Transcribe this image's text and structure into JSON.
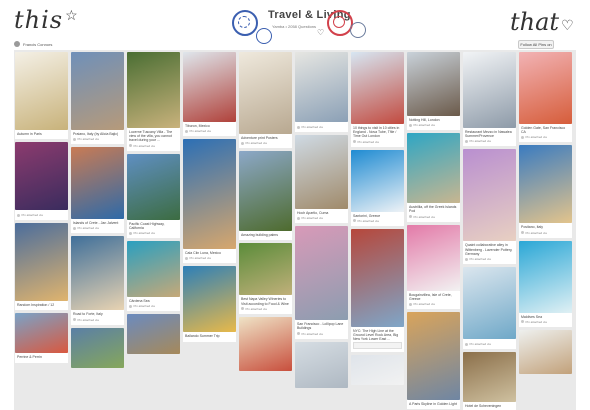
{
  "header": {
    "left_script": "this",
    "right_script": "that",
    "board_title": "Travel & Living",
    "board_meta": "Yamba • 2058 Questions",
    "user_name": "Francis Connors",
    "follow_label": "Follow All Pins on Board",
    "star_glyph": "☆",
    "heart_glyph": "♡"
  },
  "columns": [
    {
      "pins": [
        {
          "h": 78,
          "c1": "#f4f0e6",
          "c2": "#c8b27a",
          "desc": "Autumn in Paris",
          "via": "",
          "comment": false
        },
        {
          "h": 68,
          "c1": "#8c3b6e",
          "c2": "#3a2c5e",
          "desc": "",
          "via": "Pin attached via",
          "comment": false
        },
        {
          "h": 78,
          "c1": "#4b6d9c",
          "c2": "#e0b46e",
          "desc": "Random Inspiration / 12",
          "via": "",
          "comment": false
        },
        {
          "h": 40,
          "c1": "#7aa3c8",
          "c2": "#d9583f",
          "desc": "Perrine & Perrin",
          "via": "",
          "comment": false
        }
      ]
    },
    {
      "pins": [
        {
          "h": 78,
          "c1": "#6f90b9",
          "c2": "#b69a7a",
          "desc": "Praiano, Italy (by Alicia Bajic)",
          "via": "Pin attached via",
          "comment": false
        },
        {
          "h": 72,
          "c1": "#c97b54",
          "c2": "#2e6aa8",
          "desc": "Islands of Crete - Jan Jalvent",
          "via": "Pin attached via",
          "comment": false
        },
        {
          "h": 74,
          "c1": "#3f6f9a",
          "c2": "#e8d3b2",
          "desc": "Road to Forte, Italy",
          "via": "Pin attached via",
          "comment": false
        },
        {
          "h": 40,
          "c1": "#5a7fa6",
          "c2": "#86a75b",
          "desc": "",
          "via": "",
          "comment": false
        }
      ]
    },
    {
      "pins": [
        {
          "h": 76,
          "c1": "#4a6e33",
          "c2": "#c9b27c",
          "desc": "Lucerne Tuscany Villa - The view of the villa, you cannot travel during your ...",
          "via": "Pin attached via",
          "comment": false
        },
        {
          "h": 66,
          "c1": "#5f8fc2",
          "c2": "#3c6c41",
          "desc": "Pacific Coast Highway, California",
          "via": "Pin attached via",
          "comment": false
        },
        {
          "h": 56,
          "c1": "#2a9fc0",
          "c2": "#c6a978",
          "desc": "Cârdena Sea",
          "via": "Pin attached via",
          "comment": false
        },
        {
          "h": 40,
          "c1": "#6b8bbf",
          "c2": "#a6895a",
          "desc": "",
          "via": "",
          "comment": false
        }
      ]
    },
    {
      "pins": [
        {
          "h": 70,
          "c1": "#dfe6ec",
          "c2": "#b0413a",
          "desc": "Tiburon, Mexico",
          "via": "Pin attached via",
          "comment": false
        },
        {
          "h": 110,
          "c1": "#2c6fb5",
          "c2": "#d7a76d",
          "desc": "Cala Ciin Luna, Mexico",
          "via": "Pin attached via",
          "comment": false
        },
        {
          "h": 66,
          "c1": "#2d7fb8",
          "c2": "#e8b94a",
          "desc": "Bailando Summer Trip",
          "via": "",
          "comment": false
        }
      ]
    },
    {
      "pins": [
        {
          "h": 82,
          "c1": "#efe9dd",
          "c2": "#b8a890",
          "desc": "Adventure print Posters",
          "via": "Pin attached via",
          "comment": false
        },
        {
          "h": 80,
          "c1": "#8ca8c8",
          "c2": "#4e6b2e",
          "desc": "Amazing building palms",
          "via": "",
          "comment": false
        },
        {
          "h": 52,
          "c1": "#5b8c3a",
          "c2": "#c0b07a",
          "desc": "Best Napa Valley Wineries to Visit according to Food & Wine",
          "via": "Pin attached via",
          "comment": false
        },
        {
          "h": 54,
          "c1": "#efe3c6",
          "c2": "#c84f3d",
          "desc": "",
          "via": "",
          "comment": false
        }
      ]
    },
    {
      "pins": [
        {
          "h": 70,
          "c1": "#e6e6e2",
          "c2": "#8ba0b6",
          "desc": "",
          "via": "Pin attached via",
          "comment": false
        },
        {
          "h": 74,
          "c1": "#cfdae4",
          "c2": "#a08a6a",
          "desc": "Hoch Apartlo, Cuma",
          "via": "Pin attached via",
          "comment": false
        },
        {
          "h": 94,
          "c1": "#d89ab8",
          "c2": "#8c9db0",
          "desc": "San Francisco - Lollipop Lane Buildings",
          "via": "Pin attached via",
          "comment": false
        },
        {
          "h": 46,
          "c1": "#d6dde3",
          "c2": "#aeb8c2",
          "desc": "",
          "via": "",
          "comment": false
        }
      ]
    },
    {
      "pins": [
        {
          "h": 72,
          "c1": "#d7e6f2",
          "c2": "#c24a3f",
          "desc": "10 things to visit in 10 cities in England - Nova Tube, Tfile / Time Out London",
          "via": "Pin attached via",
          "comment": false
        },
        {
          "h": 62,
          "c1": "#1f8bd2",
          "c2": "#eef2f6",
          "desc": "Santorini, Greece",
          "via": "Pin attached via",
          "comment": false
        },
        {
          "h": 98,
          "c1": "#b6473b",
          "c2": "#7fa6c8",
          "desc": "NYC: The High Line at the Ground Level Rock Area, Big New York Lower East ...",
          "via": "",
          "comment": true
        },
        {
          "h": 30,
          "c1": "#dfe4ea",
          "c2": "#f2f2f2",
          "desc": "",
          "via": "",
          "comment": false
        }
      ]
    },
    {
      "pins": [
        {
          "h": 64,
          "c1": "#c9d2da",
          "c2": "#6b5a4a",
          "desc": "Notting Hill, London",
          "via": "Pin attached via",
          "comment": false
        },
        {
          "h": 70,
          "c1": "#2ea6c4",
          "c2": "#c8b690",
          "desc": "Austrillia, off the Greek Islands Pod",
          "via": "Pin attached via",
          "comment": false
        },
        {
          "h": 66,
          "c1": "#e37aa8",
          "c2": "#f2f2f2",
          "desc": "Bougainvillea, Isle of Crete, Greece",
          "via": "Pin attached via",
          "comment": false
        },
        {
          "h": 88,
          "c1": "#d9a45b",
          "c2": "#6f86a3",
          "desc": "A Paris Skyline in Golden Light",
          "via": "",
          "comment": false
        }
      ]
    },
    {
      "pins": [
        {
          "h": 76,
          "c1": "#f2f4f6",
          "c2": "#8d9aa8",
          "desc": "Restaurant Mezzo in Nawalea Summer/Provence",
          "via": "Pin attached via",
          "comment": false
        },
        {
          "h": 92,
          "c1": "#b98fd0",
          "c2": "#e8d0c2",
          "desc": "Quaint collaborative alley in Wittenberg - Lavender Pottery, Germany",
          "via": "Pin attached via",
          "comment": false
        },
        {
          "h": 72,
          "c1": "#dbe6ee",
          "c2": "#6fa8c8",
          "desc": "",
          "via": "Pin attached via",
          "comment": false
        },
        {
          "h": 50,
          "c1": "#8b6f4a",
          "c2": "#cfc1a0",
          "desc": "Hotel de Scheveningen",
          "via": "",
          "comment": false
        }
      ]
    },
    {
      "pins": [
        {
          "h": 72,
          "c1": "#f2b3b5",
          "c2": "#d65d3a",
          "desc": "Golden Gate, San Francisco CA",
          "via": "Pin attached via",
          "comment": false
        },
        {
          "h": 78,
          "c1": "#3a7bc0",
          "c2": "#e3c48c",
          "desc": "Positano, Italy",
          "via": "Pin attached via",
          "comment": false
        },
        {
          "h": 72,
          "c1": "#2aa7d6",
          "c2": "#e0f0f4",
          "desc": "Maldives Sea",
          "via": "Pin attached via",
          "comment": false
        },
        {
          "h": 44,
          "c1": "#eef0ee",
          "c2": "#c2a17a",
          "desc": "",
          "via": "",
          "comment": false
        }
      ]
    }
  ]
}
